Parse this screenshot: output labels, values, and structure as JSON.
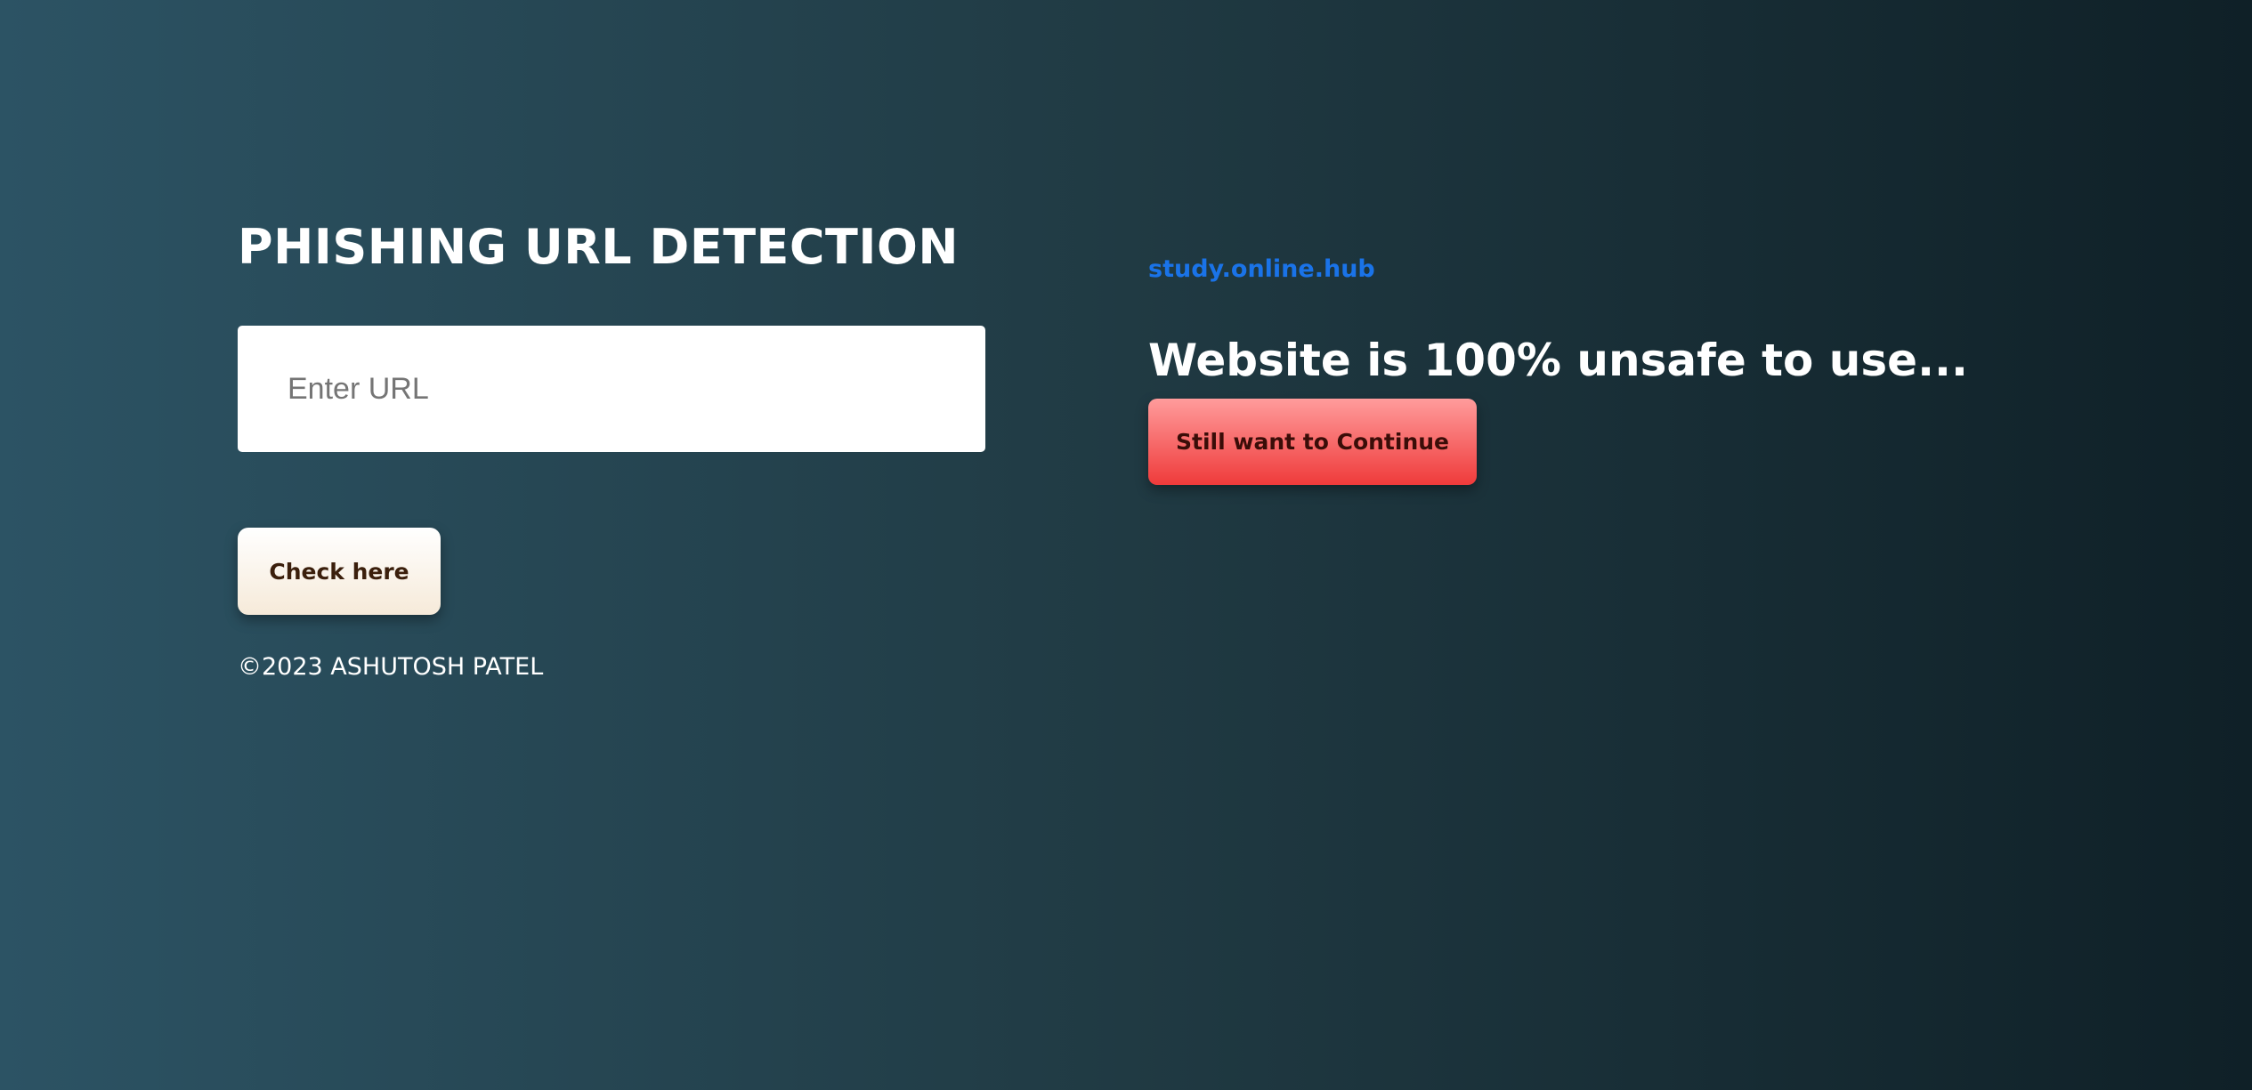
{
  "header": {
    "title": "PHISHING URL DETECTION"
  },
  "form": {
    "url_placeholder": "Enter URL",
    "url_value": "",
    "submit_label": "Check here"
  },
  "footer": {
    "copyright": "©2023 ASHUTOSH PATEL"
  },
  "result": {
    "url": "study.online.hub",
    "verdict": "Website is 100% unsafe to use...",
    "continue_label": "Still want to Continue"
  },
  "colors": {
    "background_start": "#2c5364",
    "background_end": "#0f2027",
    "link": "#1a73e8",
    "danger_button": "#ef3b3b",
    "check_button": "#f6ead9"
  }
}
